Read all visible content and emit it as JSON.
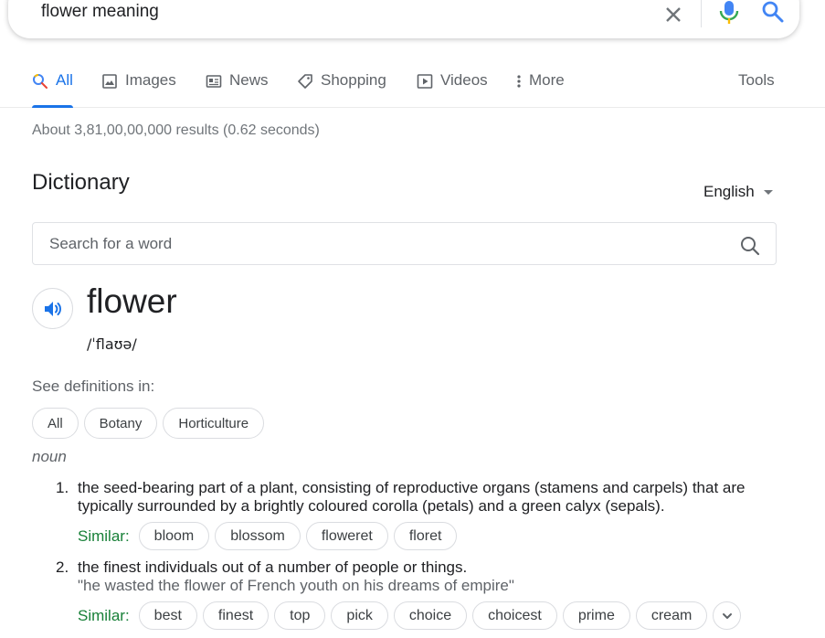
{
  "search": {
    "query": "flower meaning"
  },
  "tabs": [
    {
      "label": "All",
      "icon": "search-icon",
      "active": true
    },
    {
      "label": "Images",
      "icon": "image-icon"
    },
    {
      "label": "News",
      "icon": "news-icon"
    },
    {
      "label": "Shopping",
      "icon": "tag-icon"
    },
    {
      "label": "Videos",
      "icon": "play-icon"
    },
    {
      "label": "More",
      "icon": "more-vert-icon"
    }
  ],
  "tools_label": "Tools",
  "result_stats": "About 3,81,00,00,000 results (0.62 seconds)",
  "dictionary": {
    "title": "Dictionary",
    "language": "English",
    "search_placeholder": "Search for a word",
    "word": "flower",
    "phonetic": "/ˈflaʊə/",
    "see_definitions_label": "See definitions in:",
    "definition_chips": [
      "All",
      "Botany",
      "Horticulture"
    ],
    "part_of_speech": "noun",
    "senses": [
      {
        "number": "1.",
        "definition": "the seed-bearing part of a plant, consisting of reproductive organs (stamens and carpels) that are typically surrounded by a brightly coloured corolla (petals) and a green calyx (sepals).",
        "example": "",
        "similar_label": "Similar:",
        "similar": [
          "bloom",
          "blossom",
          "floweret",
          "floret"
        ]
      },
      {
        "number": "2.",
        "definition": "the finest individuals out of a number of people or things.",
        "example": "\"he wasted the flower of French youth on his dreams of empire\"",
        "similar_label": "Similar:",
        "similar": [
          "best",
          "finest",
          "top",
          "pick",
          "choice",
          "choicest",
          "prime",
          "cream"
        ]
      }
    ]
  },
  "colors": {
    "accent_blue": "#1a73e8",
    "similar_green": "#188038",
    "muted_text": "#5f6368"
  }
}
